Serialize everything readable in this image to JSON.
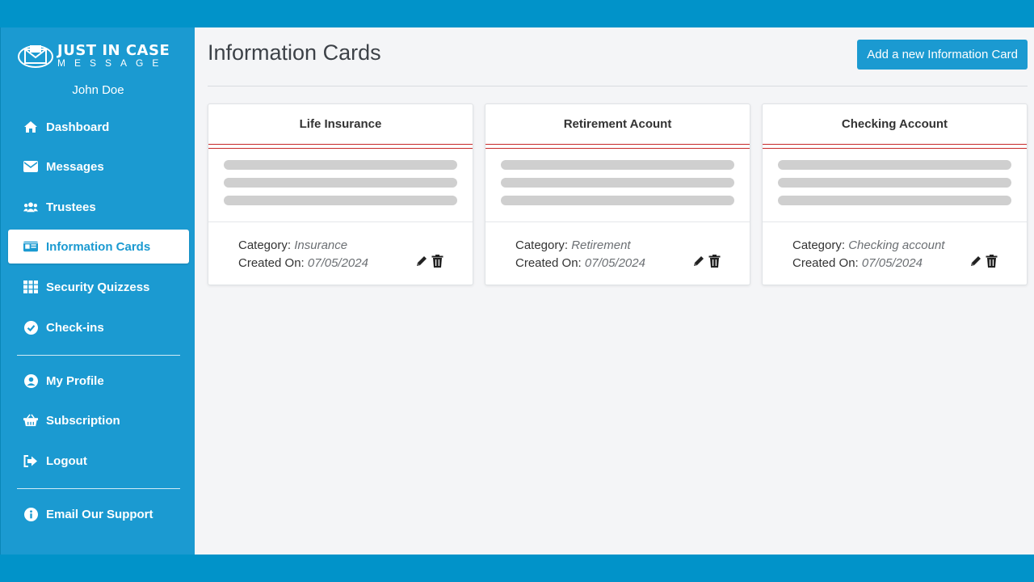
{
  "brand": {
    "line1": "JUST IN CASE",
    "line2": "MESSAGE"
  },
  "user": {
    "name": "John Doe"
  },
  "nav": {
    "dashboard": "Dashboard",
    "messages": "Messages",
    "trustees": "Trustees",
    "information_cards": "Information Cards",
    "security_quizzes": "Security Quizzess",
    "checkins": "Check-ins",
    "my_profile": "My Profile",
    "subscription": "Subscription",
    "logout": "Logout",
    "email_support": "Email Our Support"
  },
  "page": {
    "title": "Information Cards",
    "add_button": "Add a new Information Card"
  },
  "labels": {
    "category": "Category:",
    "created_on": "Created On:"
  },
  "cards": [
    {
      "title": "Life Insurance",
      "category": "Insurance",
      "created": "07/05/2024"
    },
    {
      "title": "Retirement Acount",
      "category": "Retirement",
      "created": "07/05/2024"
    },
    {
      "title": "Checking Account",
      "category": "Checking account",
      "created": "07/05/2024"
    }
  ],
  "colors": {
    "accent": "#1b9ad1",
    "frame": "#0193c9",
    "card_rule": "#c62828"
  }
}
